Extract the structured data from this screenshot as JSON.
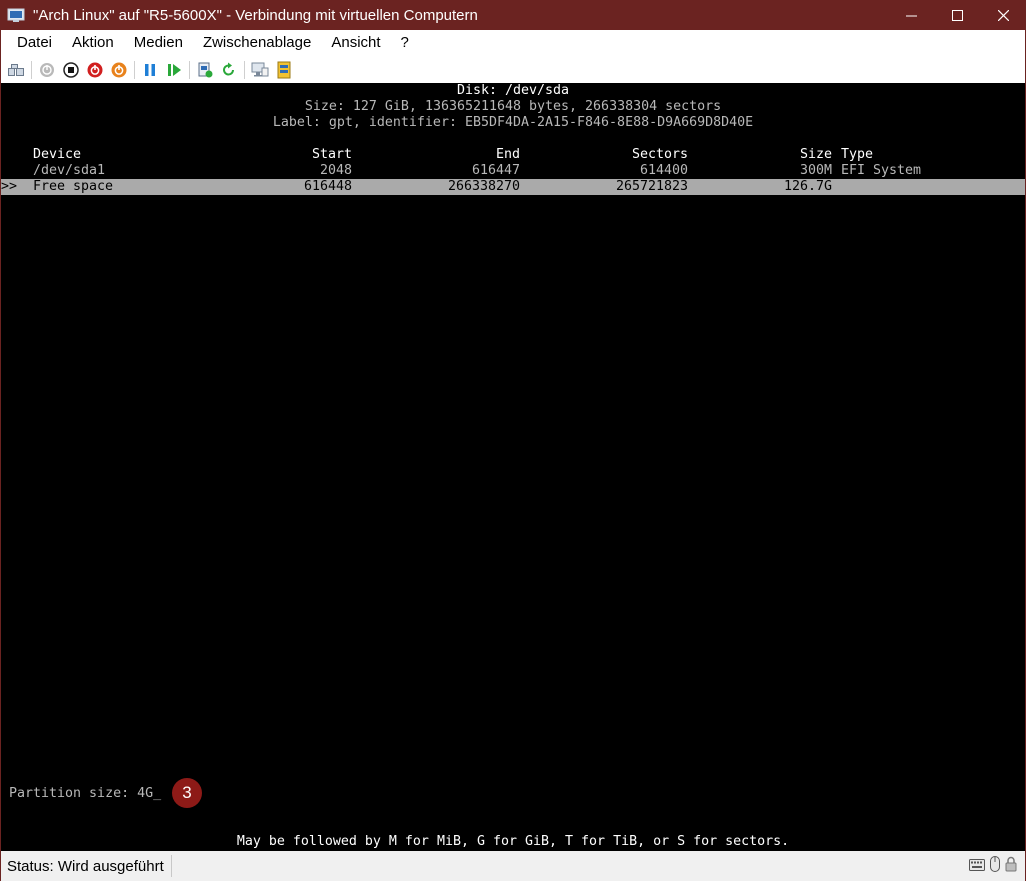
{
  "window": {
    "title": "\"Arch Linux\" auf \"R5-5600X\" - Verbindung mit virtuellen Computern",
    "controls": [
      "minimize-icon",
      "maximize-icon",
      "close-icon"
    ]
  },
  "menu": [
    "Datei",
    "Aktion",
    "Medien",
    "Zwischenablage",
    "Ansicht",
    "?"
  ],
  "toolbar": {
    "buttons": [
      "ctrl-alt-del-icon",
      "start-icon",
      "turn-off-icon",
      "shutdown-icon",
      "save-state-icon",
      "pause-icon",
      "resume-icon",
      "checkpoint-icon",
      "revert-icon",
      "enhanced-session-icon",
      "share-icon"
    ]
  },
  "terminal": {
    "disk": "Disk: /dev/sda",
    "size": "Size: 127 GiB, 136365211648 bytes, 266338304 sectors",
    "label": "Label: gpt, identifier: EB5DF4DA-2A15-F846-8E88-D9A669D8D40E",
    "headers": {
      "device": "Device",
      "start": "Start",
      "end": "End",
      "sectors": "Sectors",
      "size": "Size",
      "type": "Type"
    },
    "rows": [
      {
        "marker": "",
        "device": "/dev/sda1",
        "start": "2048",
        "end": "616447",
        "sectors": "614400",
        "size": "300M",
        "type": "EFI System",
        "selected": false
      },
      {
        "marker": ">>",
        "device": "Free space",
        "start": "616448",
        "end": "266338270",
        "sectors": "265721823",
        "size": "126.7G",
        "type": "",
        "selected": true
      }
    ],
    "prompt_label": "Partition size: ",
    "prompt_value": "4G",
    "cursor": "_",
    "hint": "May be followed by M for MiB, G for GiB, T for TiB, or S for sectors.",
    "annotation_badge": "3"
  },
  "status": {
    "text": "Status: Wird ausgeführt",
    "icons": [
      "keyboard-icon",
      "mouse-icon",
      "lock-icon"
    ]
  }
}
